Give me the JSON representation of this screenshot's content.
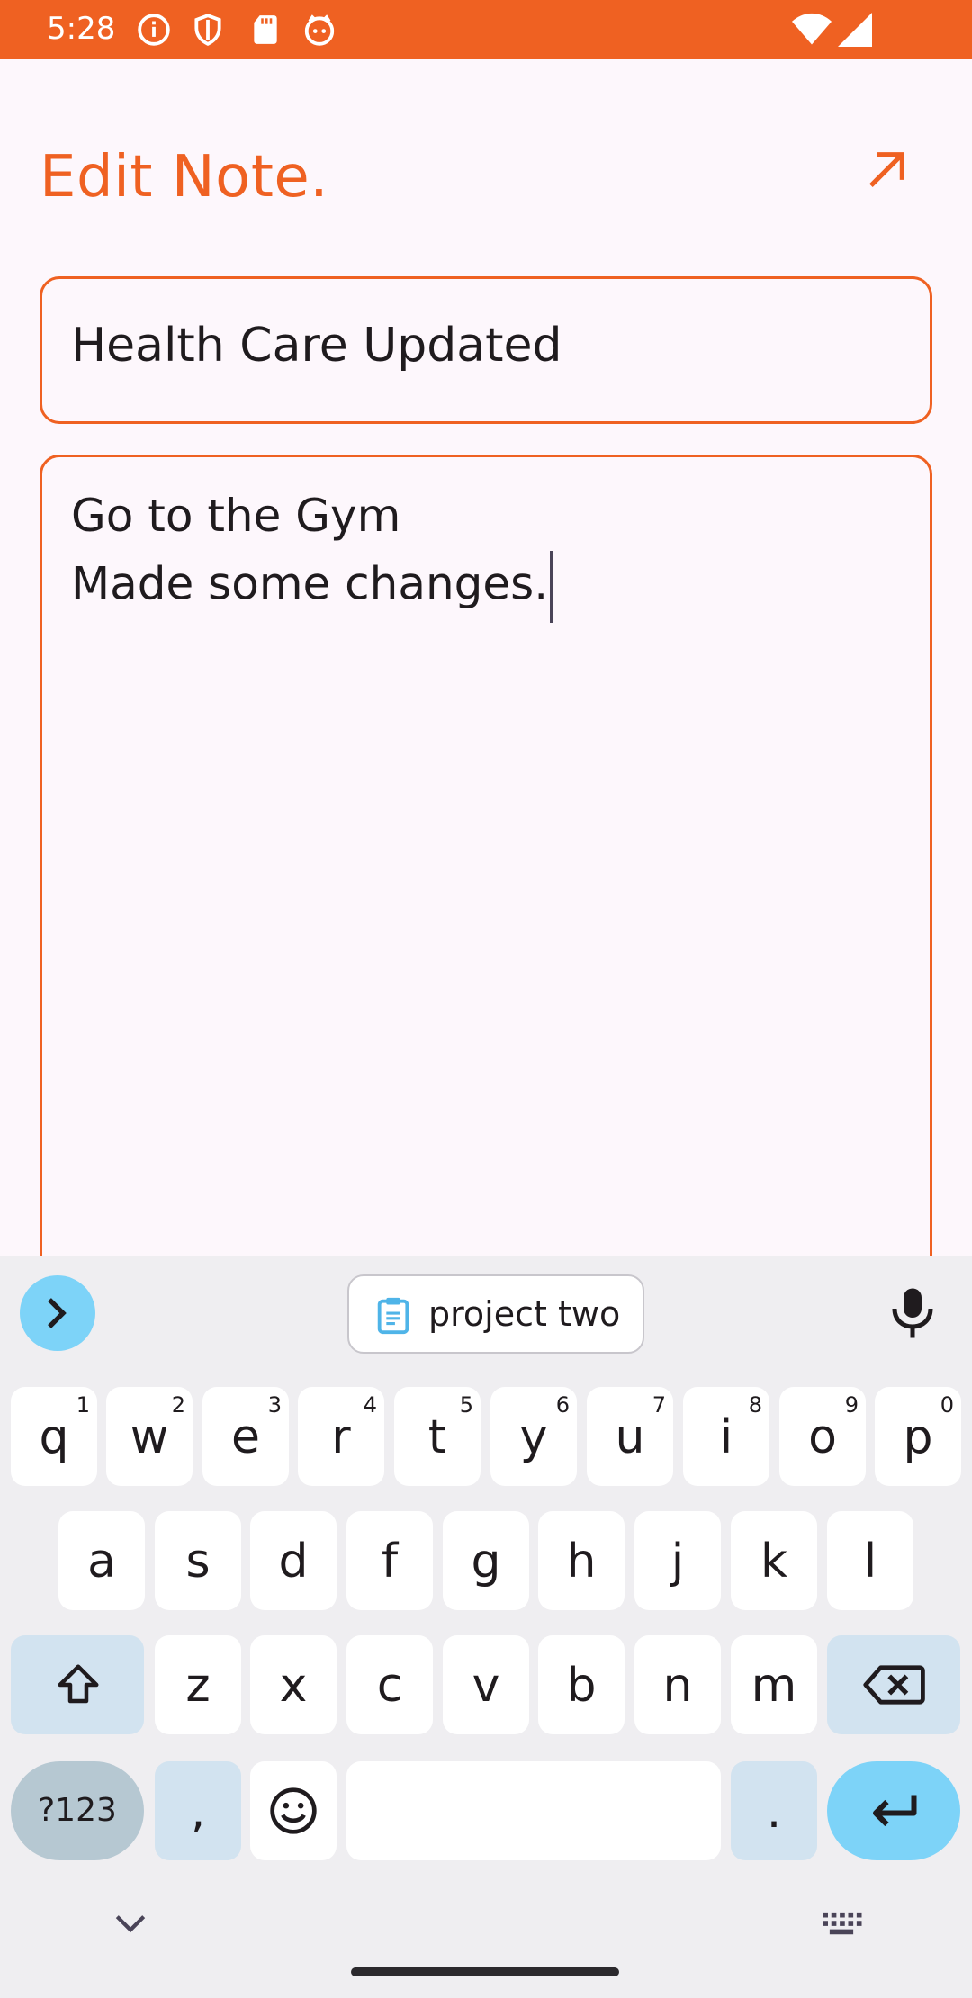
{
  "status_bar": {
    "time": "5:28",
    "background": "#EF6122",
    "left_icons": [
      "info-icon",
      "shield-icon",
      "sd-card-icon",
      "cat-face-icon"
    ],
    "right_icons": [
      "wifi-icon",
      "cell-signal-icon"
    ]
  },
  "header": {
    "title": "Edit Note.",
    "action_icon": "arrow-up-right-icon",
    "accent_color": "#EF6122"
  },
  "note": {
    "title_value": "Health Care Updated",
    "body_lines": [
      "Go to the Gym",
      "Made some changes."
    ]
  },
  "keyboard": {
    "suggestion_chip": "project two",
    "row1": [
      {
        "ch": "q",
        "sup": "1"
      },
      {
        "ch": "w",
        "sup": "2"
      },
      {
        "ch": "e",
        "sup": "3"
      },
      {
        "ch": "r",
        "sup": "4"
      },
      {
        "ch": "t",
        "sup": "5"
      },
      {
        "ch": "y",
        "sup": "6"
      },
      {
        "ch": "u",
        "sup": "7"
      },
      {
        "ch": "i",
        "sup": "8"
      },
      {
        "ch": "o",
        "sup": "9"
      },
      {
        "ch": "p",
        "sup": "0"
      }
    ],
    "row2": [
      "a",
      "s",
      "d",
      "f",
      "g",
      "h",
      "j",
      "k",
      "l"
    ],
    "row3": [
      "z",
      "x",
      "c",
      "v",
      "b",
      "n",
      "m"
    ],
    "symbols_label": "?123",
    "comma_label": ",",
    "period_label": ".",
    "accent_color": "#7DD3F8"
  }
}
